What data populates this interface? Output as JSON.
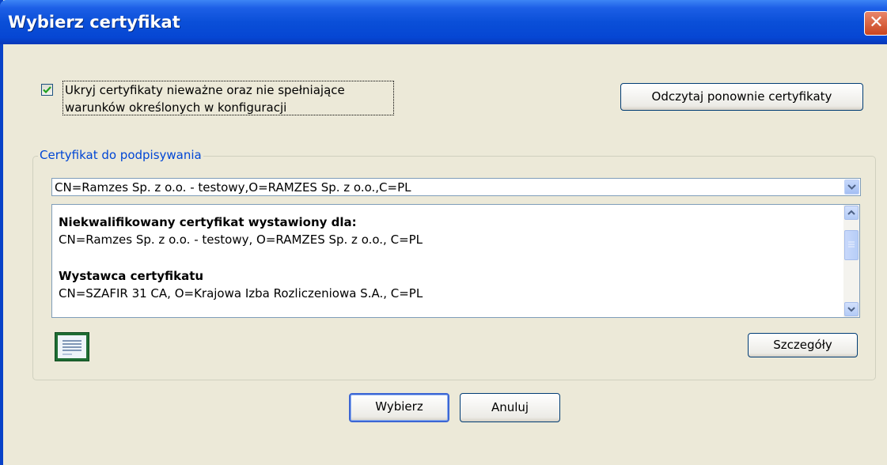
{
  "window": {
    "title": "Wybierz certyfikat",
    "close_label": "✕"
  },
  "options": {
    "hide_invalid_checked": true,
    "hide_invalid_label_line1": "Ukryj certyfikaty nieważne oraz nie spełniające",
    "hide_invalid_label_line2": "warunków określonych w konfiguracji",
    "reload_label": "Odczytaj ponownie certyfikaty"
  },
  "signing_group": {
    "legend": "Certyfikat do podpisywania",
    "selected_certificate": "CN=Ramzes Sp. z o.o. - testowy,O=RAMZES Sp. z o.o.,C=PL",
    "details_panel": {
      "subject_heading": "Niekwalifikowany certyfikat wystawiony dla:",
      "subject_value": "CN=Ramzes Sp. z o.o. - testowy, O=RAMZES Sp. z o.o., C=PL",
      "issuer_heading": "Wystawca certyfikatu",
      "issuer_value": "CN=SZAFIR 31 CA, O=Krajowa Izba Rozliczeniowa S.A., C=PL"
    },
    "details_button_label": "Szczegóły"
  },
  "footer": {
    "select_label": "Wybierz",
    "cancel_label": "Anuluj"
  },
  "icons": {
    "close": "close-icon",
    "checkmark": "checkmark-icon",
    "dropdown": "chevron-down-icon",
    "scroll_up": "arrow-up-icon",
    "scroll_down": "arrow-down-icon",
    "certificate": "certificate-icon"
  },
  "colors": {
    "titlebar": "#0a4fd8",
    "dialog_bg": "#ece9d8",
    "group_legend": "#0046d5",
    "close_button": "#d4502c"
  }
}
